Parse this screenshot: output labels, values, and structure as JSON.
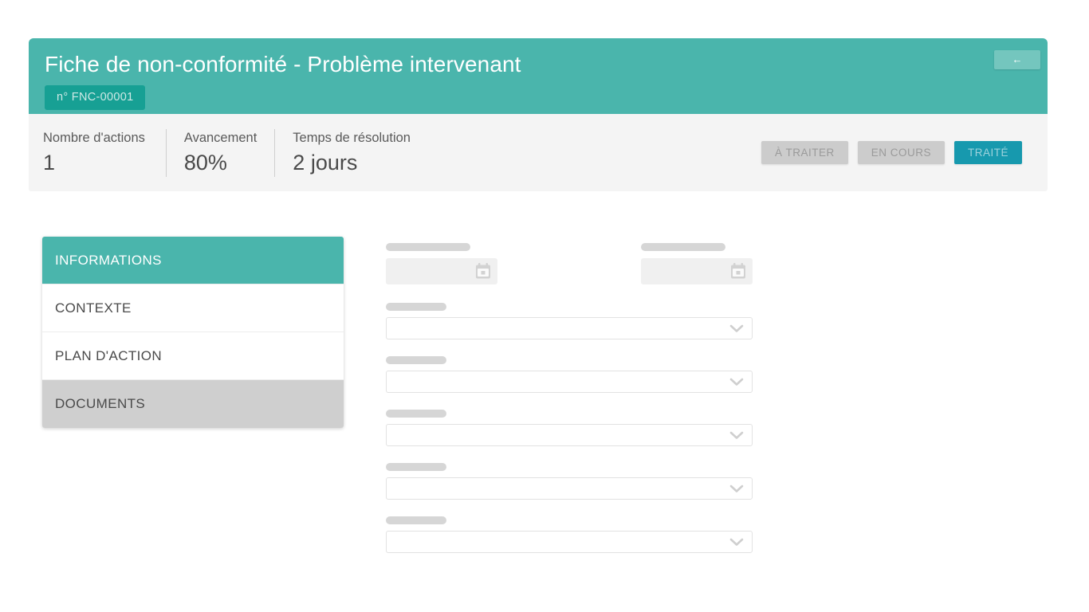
{
  "header": {
    "title": "Fiche de non-conformité - Problème intervenant",
    "badge": "n° FNC-00001",
    "back_label": "←",
    "bg_color": "#4ab5ac",
    "badge_color": "#17a094"
  },
  "stats": {
    "items": [
      {
        "label": "Nombre d'actions",
        "value": "1"
      },
      {
        "label": "Avancement",
        "value": "80%"
      },
      {
        "label": "Temps de résolution",
        "value": "2 jours"
      }
    ],
    "status_buttons": [
      {
        "label": "À TRAITER",
        "active": false
      },
      {
        "label": "EN COURS",
        "active": false
      },
      {
        "label": "TRAITÉ",
        "active": true
      }
    ],
    "active_color": "#1799ae",
    "inactive_color": "#cccccc",
    "bar_bg": "#f4f4f4"
  },
  "sidebar": {
    "items": [
      {
        "label": "INFORMATIONS",
        "state": "active"
      },
      {
        "label": "CONTEXTE",
        "state": "default"
      },
      {
        "label": "PLAN D'ACTION",
        "state": "default"
      },
      {
        "label": "DOCUMENTS",
        "state": "hover"
      }
    ]
  },
  "form": {
    "date_fields": [
      {
        "label_width": 106,
        "value": "",
        "icon": "calendar-icon"
      },
      {
        "label_width": 106,
        "value": "",
        "icon": "calendar-icon"
      }
    ],
    "select_fields": [
      {
        "label_width": 76,
        "value": "",
        "icon": "chevron-down-icon"
      },
      {
        "label_width": 76,
        "value": "",
        "icon": "chevron-down-icon"
      },
      {
        "label_width": 76,
        "value": "",
        "icon": "chevron-down-icon"
      },
      {
        "label_width": 76,
        "value": "",
        "icon": "chevron-down-icon"
      },
      {
        "label_width": 76,
        "value": "",
        "icon": "chevron-down-icon"
      }
    ],
    "skeleton_color": "#d6d6d6"
  }
}
